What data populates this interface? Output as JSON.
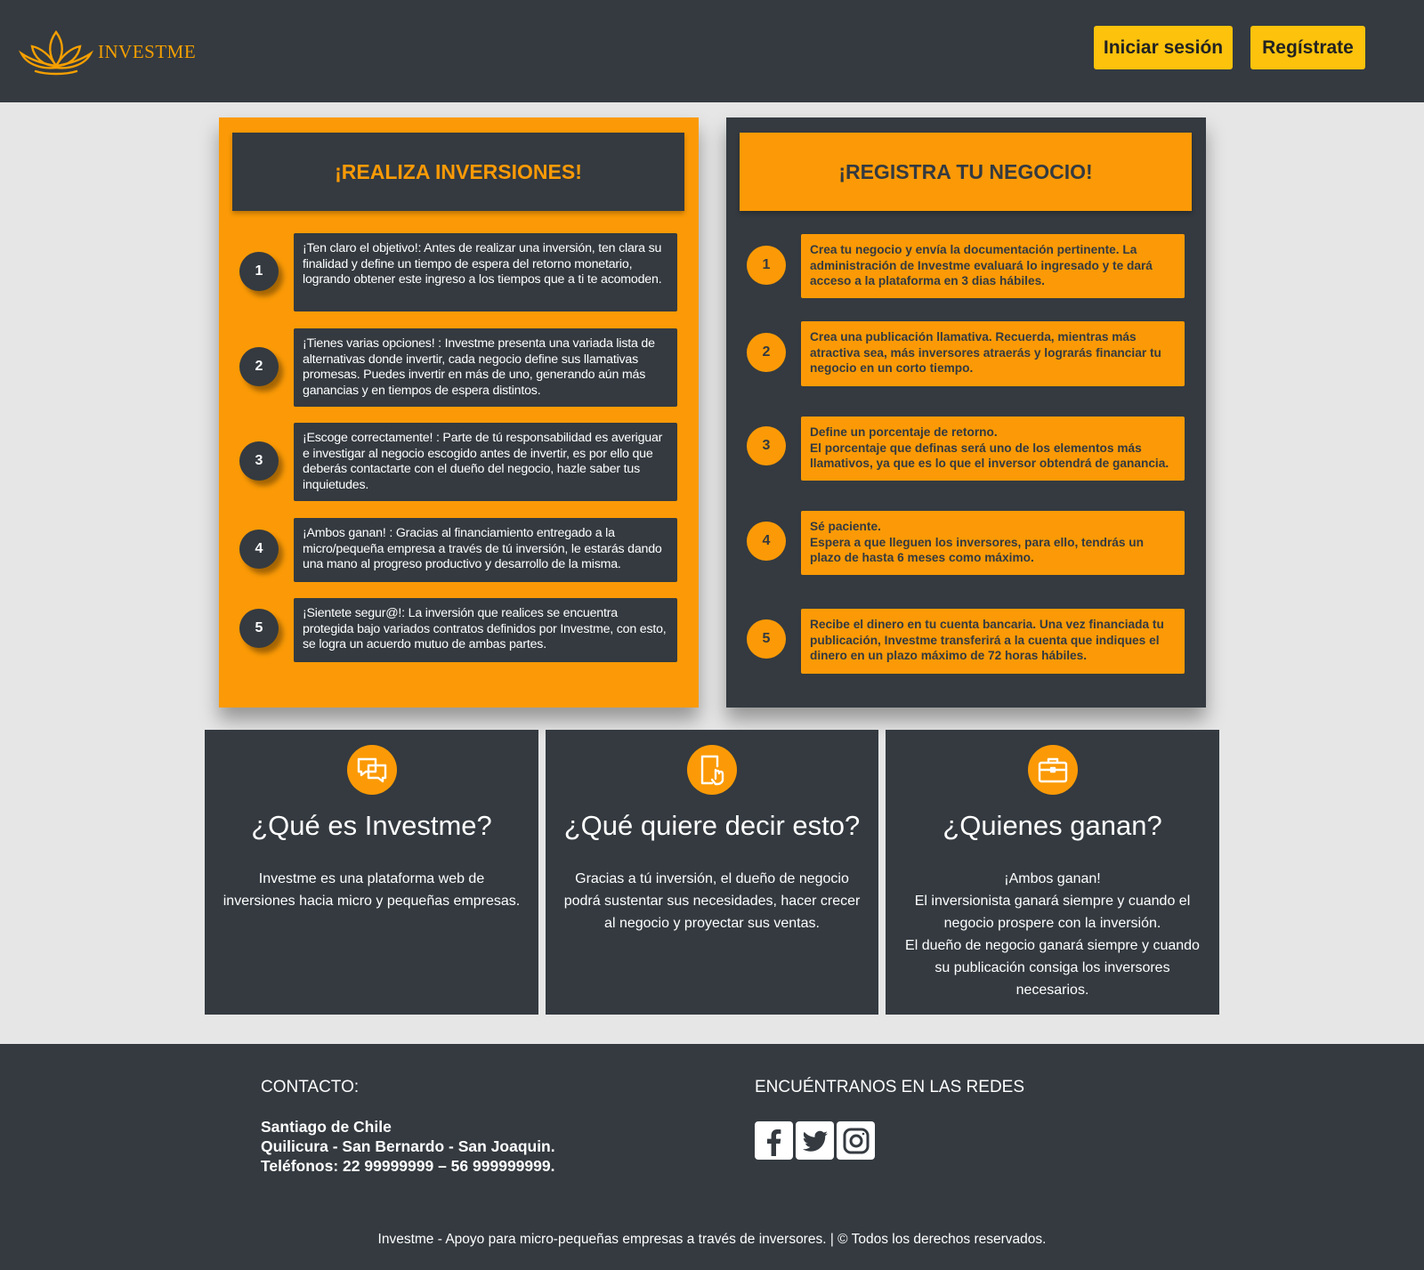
{
  "header": {
    "brand": "INVESTME",
    "login_label": "Iniciar sesión",
    "register_label": "Regístrate"
  },
  "invest_panel": {
    "title": "¡REALIZA INVERSIONES!",
    "steps": [
      {
        "num": "1",
        "text": "¡Ten claro el objetivo!: Antes de realizar una inversión, ten clara su finalidad y define un tiempo de espera del retorno monetario, logrando obtener este ingreso a los tiempos que a ti te acomoden."
      },
      {
        "num": "2",
        "text": "¡Tienes varias opciones! : Investme presenta una variada lista de alternativas donde invertir, cada negocio define sus llamativas promesas. Puedes invertir en más de uno, generando aún más ganancias y en tiempos de espera distintos."
      },
      {
        "num": "3",
        "text": "¡Escoge correctamente! : Parte de tú responsabilidad es averiguar e investigar al negocio escogido antes de invertir, es por ello que deberás contactarte con el dueño del negocio, hazle saber tus inquietudes."
      },
      {
        "num": "4",
        "text": "¡Ambos ganan! : Gracias al financiamiento entregado a la micro/pequeña empresa a través de tú inversión, le estarás dando una mano al progreso productivo y desarrollo de la misma."
      },
      {
        "num": "5",
        "text": "¡Sientete segur@!: La inversión que realices se encuentra protegida bajo variados contratos definidos por Investme, con esto, se logra un acuerdo mutuo de ambas partes."
      }
    ]
  },
  "business_panel": {
    "title": "¡REGISTRA TU NEGOCIO!",
    "steps": [
      {
        "num": "1",
        "text": "Crea tu negocio y envía la documentación pertinente. La administración de Investme evaluará lo ingresado y te dará acceso a la plataforma en 3 dias hábiles."
      },
      {
        "num": "2",
        "text": "Crea una publicación llamativa. Recuerda, mientras más atractiva sea, más inversores atraerás y lograrás financiar tu negocio en un corto tiempo."
      },
      {
        "num": "3",
        "text": "Define un porcentaje de retorno.\nEl porcentaje que definas será uno de los elementos más llamativos, ya que es lo que el inversor obtendrá de ganancia."
      },
      {
        "num": "4",
        "text": "Sé paciente.\nEspera a que lleguen los inversores, para ello, tendrás un plazo de hasta 6 meses como máximo."
      },
      {
        "num": "5",
        "text": "Recibe el dinero en tu cuenta bancaria. Una vez financiada tu publicación, Investme transferirá a la cuenta que indiques el dinero en un plazo máximo de 72 horas hábiles."
      }
    ]
  },
  "cards": [
    {
      "icon": "chat-bubbles-icon",
      "title": "¿Qué es Investme?",
      "text": "Investme es una plataforma web de inversiones hacia micro y pequeñas empresas."
    },
    {
      "icon": "touch-document-icon",
      "title": "¿Qué quiere decir esto?",
      "text": "Gracias a tú inversión, el dueño de negocio podrá sustentar sus necesidades, hacer crecer al negocio y proyectar sus ventas."
    },
    {
      "icon": "briefcase-icon",
      "title": "¿Quienes ganan?",
      "text": "¡Ambos ganan!\nEl inversionista ganará siempre y cuando el negocio prospere con la inversión.\nEl dueño de negocio ganará siempre y cuando su publicación consiga los inversores necesarios."
    }
  ],
  "footer": {
    "contact_title": "CONTACTO:",
    "contact_city": "Santiago de Chile",
    "contact_areas": "Quilicura - San Bernardo - San Joaquin.",
    "contact_phones": "Teléfonos: 22 99999999 – 56 999999999.",
    "social_title": "ENCUÉNTRANOS EN LAS REDES",
    "social_icons": [
      "facebook-icon",
      "twitter-icon",
      "instagram-icon"
    ],
    "copyright": "Investme - Apoyo para micro-pequeñas empresas a través de inversores. | © Todos los derechos reservados."
  },
  "colors": {
    "dark": "#343a40",
    "orange": "#fb9a06",
    "button_yellow": "#fcc20c",
    "background": "#e6e6e6"
  }
}
